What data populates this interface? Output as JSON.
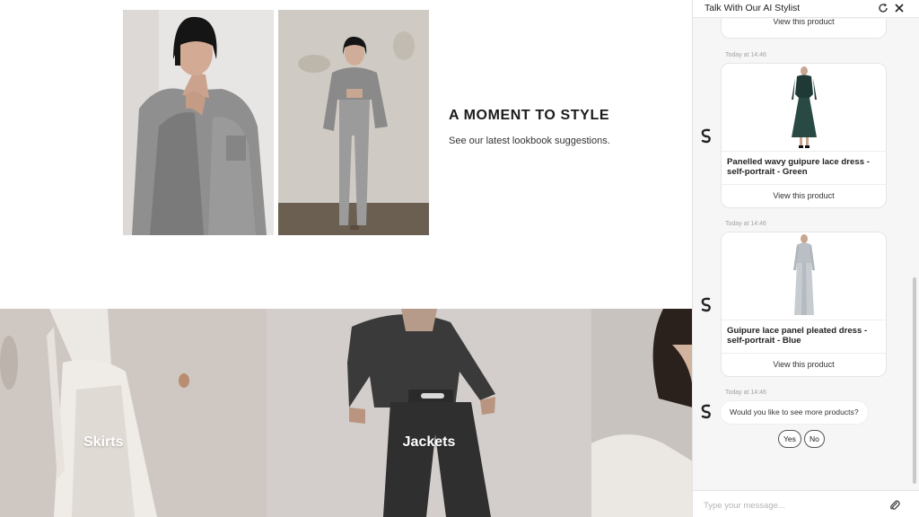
{
  "promo": {
    "title": "A MOMENT TO STYLE",
    "subtitle": "See our latest lookbook suggestions."
  },
  "categories": [
    {
      "label": "Skirts"
    },
    {
      "label": "Jackets"
    }
  ],
  "chat": {
    "title": "Talk With Our AI Stylist",
    "header_icons": {
      "refresh": "refresh-icon",
      "close": "close-icon"
    },
    "previous_view_label": "View this product",
    "messages": [
      {
        "timestamp": "Today at 14:46",
        "product_name": "Panelled wavy guipure lace dress - self-portrait - Green",
        "view_label": "View this product",
        "dress_color": "#1f3a36"
      },
      {
        "timestamp": "Today at 14:46",
        "product_name": "Guipure lace panel pleated dress - self-portrait - Blue",
        "view_label": "View this product",
        "dress_color": "#b9bfc4"
      },
      {
        "timestamp": "Today at 14:46",
        "text": "Would you like to see more products?"
      }
    ],
    "quick_replies": [
      "Yes",
      "No"
    ],
    "composer": {
      "placeholder": "Type your message..."
    },
    "attach_icon": "paperclip-icon"
  }
}
